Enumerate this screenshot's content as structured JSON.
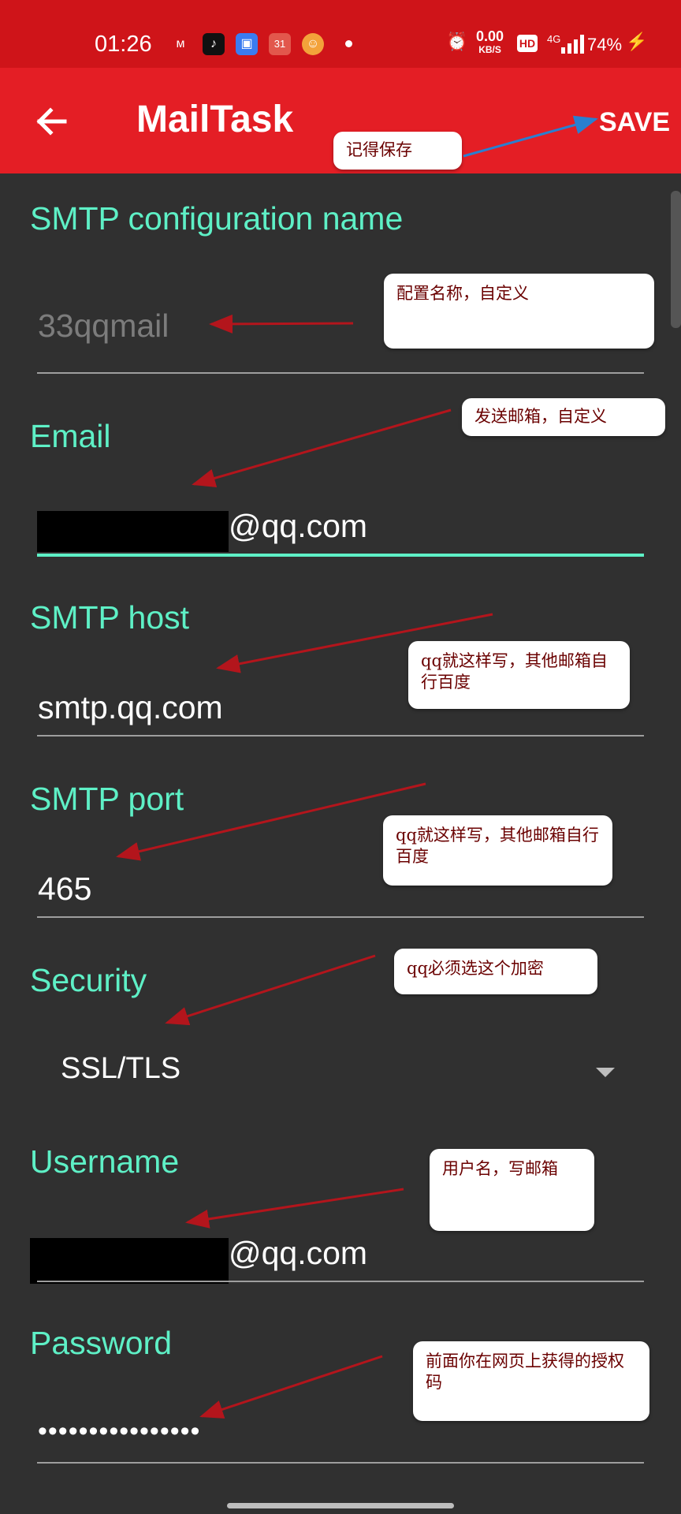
{
  "status_bar": {
    "time": "01:26",
    "apps": [
      {
        "icon": "mi-icon",
        "glyph": "ᴍ",
        "color": "#cf1419"
      },
      {
        "icon": "tiktok-icon",
        "glyph": "♪",
        "color": "#111111"
      },
      {
        "icon": "multiwindow-icon",
        "glyph": "▣",
        "color": "#3b7cf0"
      },
      {
        "icon": "calendar-icon",
        "glyph": "31",
        "color": "#e2574c"
      },
      {
        "icon": "game-avatar-icon",
        "glyph": "☺",
        "color": "#f3a23a"
      }
    ],
    "speed_value": "0.00",
    "speed_unit": "KB/S",
    "hd": "HD",
    "network": "4G",
    "battery": "74%"
  },
  "appbar": {
    "title": "MailTask",
    "save_label": "SAVE"
  },
  "form": {
    "config_name": {
      "label": "SMTP configuration name",
      "placeholder": "33qqmail"
    },
    "email": {
      "label": "Email",
      "value": "@qq.com"
    },
    "host": {
      "label": "SMTP host",
      "value": "smtp.qq.com"
    },
    "port": {
      "label": "SMTP port",
      "value": "465"
    },
    "security": {
      "label": "Security",
      "value": "SSL/TLS"
    },
    "username": {
      "label": "Username",
      "value": "@qq.com"
    },
    "password": {
      "label": "Password",
      "value": "••••••••••••••••"
    }
  },
  "annotations": {
    "save_note": "记得保存",
    "config_note": "配置名称，自定义",
    "email_note": "发送邮箱，自定义",
    "host_note": "qq就这样写，其他邮箱自行百度",
    "port_note": "qq就这样写，其他邮箱自行百度",
    "security_note": "qq必须选这个加密",
    "username_note": "用户名，写邮箱",
    "password_note": "前面你在网页上获得的授权码"
  },
  "colors": {
    "statusbar": "#cf1419",
    "appbar": "#e41e25",
    "background": "#303030",
    "accent": "#5ef0c6",
    "arrow_red": "#b3151c",
    "arrow_blue": "#2a7fd0"
  }
}
